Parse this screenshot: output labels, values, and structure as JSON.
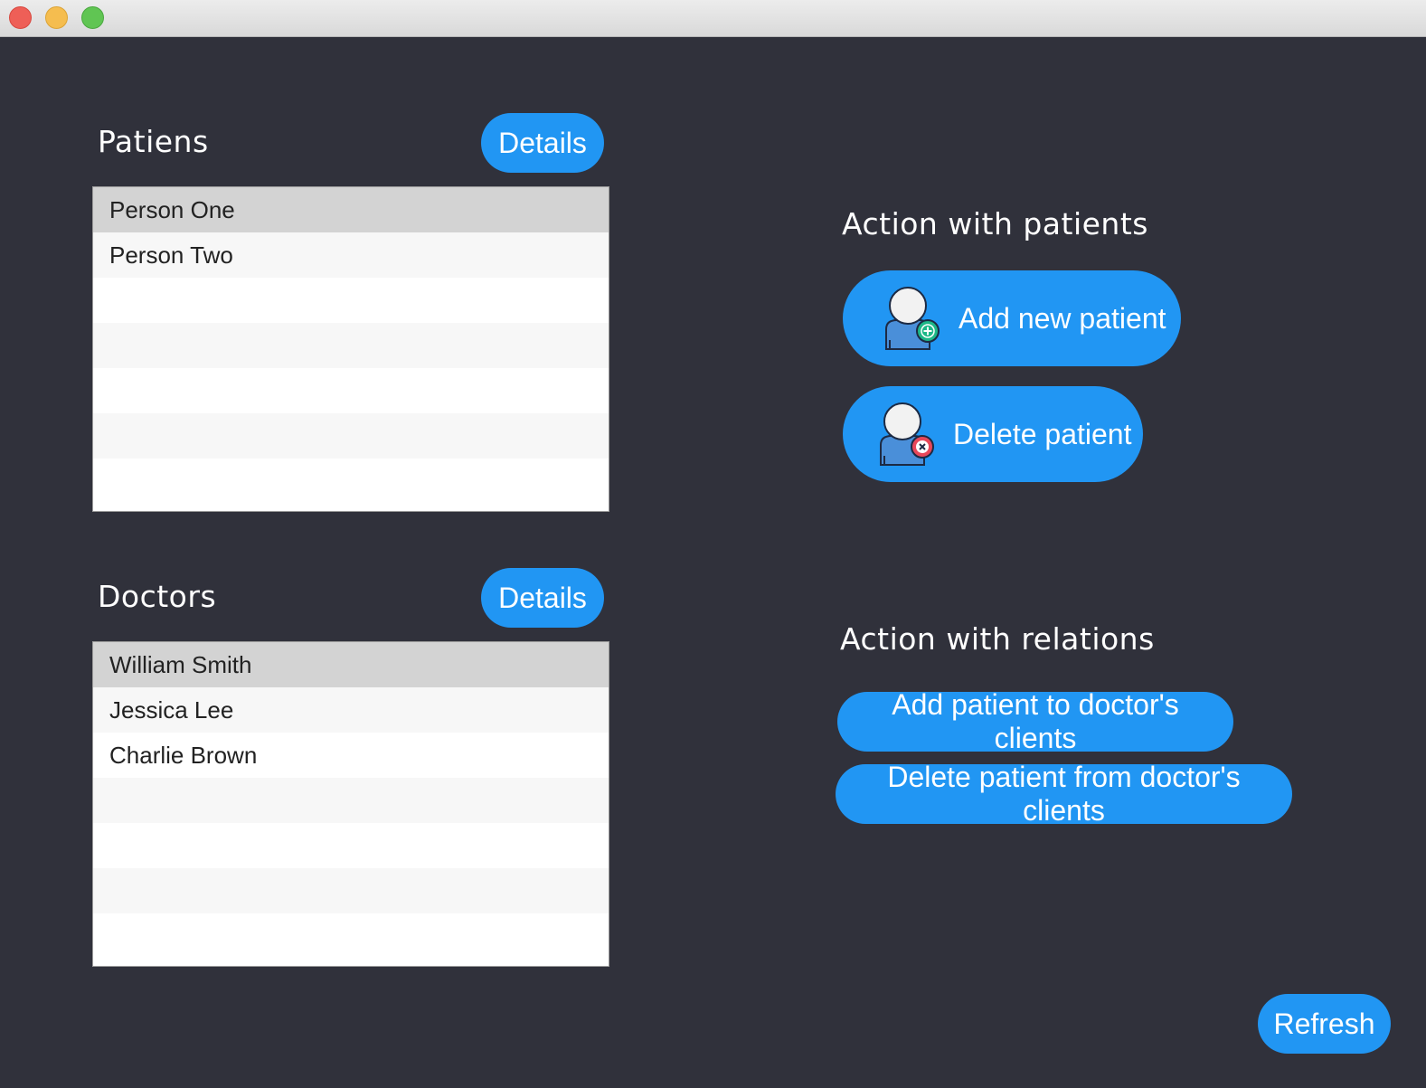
{
  "window": {
    "controls": [
      "close",
      "minimize",
      "maximize"
    ]
  },
  "patients": {
    "heading": "Patiens",
    "details_label": "Details",
    "items": [
      "Person One",
      "Person Two",
      "",
      "",
      "",
      "",
      ""
    ],
    "selected_index": 0
  },
  "doctors": {
    "heading": "Doctors",
    "details_label": "Details",
    "items": [
      "William Smith",
      "Jessica Lee",
      "Charlie Brown",
      "",
      "",
      "",
      ""
    ],
    "selected_index": 0
  },
  "patient_actions": {
    "heading": "Action with patients",
    "add_label": "Add new patient",
    "add_icon": "user-add-icon",
    "delete_label": "Delete patient",
    "delete_icon": "user-delete-icon"
  },
  "relation_actions": {
    "heading": "Action with relations",
    "add_label": "Add patient to doctor's clients",
    "delete_label": "Delete patient from doctor's clients"
  },
  "refresh_label": "Refresh",
  "colors": {
    "background": "#30313b",
    "accent": "#2196f3",
    "add_badge": "#1db887",
    "delete_badge": "#e8475a"
  }
}
